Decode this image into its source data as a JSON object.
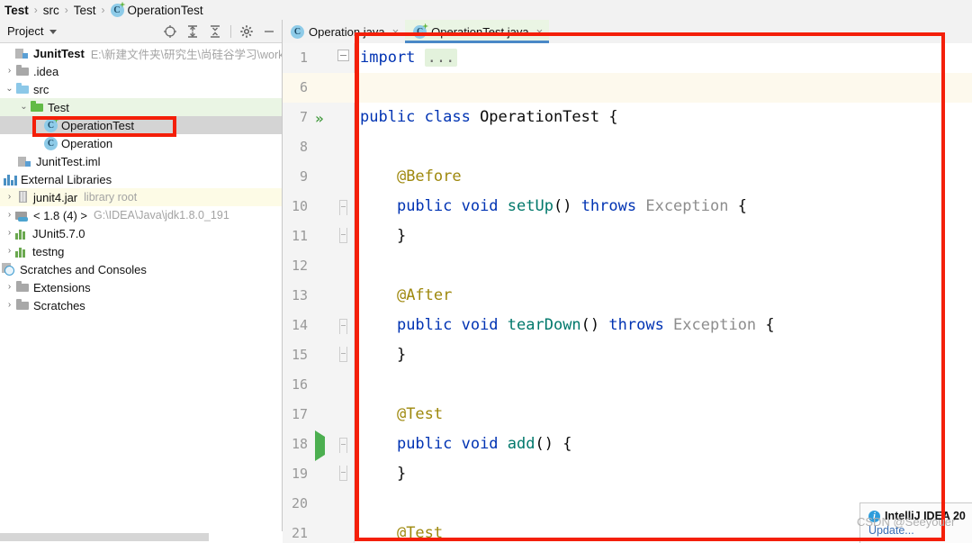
{
  "breadcrumb": {
    "items": [
      {
        "label": "Test",
        "icon": "none",
        "bold": true
      },
      {
        "label": "src",
        "icon": "none",
        "bold": false
      },
      {
        "label": "Test",
        "icon": "none",
        "bold": false
      },
      {
        "label": "OperationTest",
        "icon": "test-class-icon",
        "bold": false
      }
    ],
    "separator": "›"
  },
  "project_panel": {
    "title": "Project",
    "tools": [
      {
        "name": "locate-icon"
      },
      {
        "name": "expand-all-icon"
      },
      {
        "name": "collapse-all-icon"
      },
      {
        "name": "settings-gear-icon"
      },
      {
        "name": "hide-panel-icon"
      }
    ],
    "tree": [
      {
        "twist": "",
        "icon": "module-icon",
        "label": "JunitTest",
        "bold": true,
        "sub": "E:\\新建文件夹\\研究生\\尚硅谷学习\\workspa",
        "indent": 0,
        "state": "normal"
      },
      {
        "twist": "›",
        "icon": "folder-icon",
        "label": ".idea",
        "indent": 1,
        "state": "normal"
      },
      {
        "twist": "⌄",
        "icon": "folder-blue-icon",
        "label": "src",
        "indent": 1,
        "state": "normal"
      },
      {
        "twist": "⌄",
        "icon": "folder-green-icon",
        "label": "Test",
        "indent": 2,
        "state": "green"
      },
      {
        "twist": "",
        "icon": "test-class-icon",
        "label": "OperationTest",
        "indent": 3,
        "state": "selected"
      },
      {
        "twist": "",
        "icon": "class-icon",
        "label": "Operation",
        "indent": 2,
        "state": "normal"
      },
      {
        "twist": "",
        "icon": "iml-module-icon",
        "label": "JunitTest.iml",
        "indent": 1,
        "state": "normal"
      },
      {
        "twist": "",
        "icon": "libraries-icon",
        "label": "External Libraries",
        "indent": 0,
        "state": "normal"
      },
      {
        "twist": "›",
        "icon": "jar-icon",
        "label": "junit4.jar",
        "sub": "library root",
        "indent": 1,
        "state": "yellowish"
      },
      {
        "twist": "›",
        "icon": "sdk-icon",
        "label": "< 1.8 (4) >",
        "sub": "G:\\IDEA\\Java\\jdk1.8.0_191",
        "indent": 1,
        "state": "normal"
      },
      {
        "twist": "›",
        "icon": "library-icon",
        "label": "JUnit5.7.0",
        "indent": 1,
        "state": "normal"
      },
      {
        "twist": "›",
        "icon": "library-icon",
        "label": "testng",
        "indent": 1,
        "state": "normal"
      },
      {
        "twist": "",
        "icon": "scratches-icon",
        "label": "Scratches and Consoles",
        "indent": 0,
        "state": "normal"
      },
      {
        "twist": "›",
        "icon": "folder-icon",
        "label": "Extensions",
        "indent": 1,
        "state": "normal"
      },
      {
        "twist": "›",
        "icon": "folder-icon",
        "label": "Scratches",
        "indent": 1,
        "state": "normal"
      }
    ]
  },
  "editor": {
    "tabs": [
      {
        "label": "Operation.java",
        "icon": "class-icon",
        "active": false,
        "close": "×"
      },
      {
        "label": "OperationTest.java",
        "icon": "test-class-icon",
        "active": true,
        "close": "×"
      }
    ],
    "lines": [
      {
        "num": "1",
        "gutter": "fold-collapsed",
        "run": "",
        "caret": false,
        "tokens": [
          {
            "t": "import",
            "c": "k"
          },
          {
            "t": " ",
            "c": ""
          },
          {
            "t": "...",
            "c": "fold-ellipsis"
          }
        ]
      },
      {
        "num": "6",
        "gutter": "",
        "run": "",
        "caret": true,
        "tokens": []
      },
      {
        "num": "7",
        "gutter": "",
        "run": "run-all-icon",
        "caret": false,
        "tokens": [
          {
            "t": "public class ",
            "c": "k"
          },
          {
            "t": "OperationTest",
            "c": "cls"
          },
          {
            "t": " {",
            "c": "cls"
          }
        ]
      },
      {
        "num": "8",
        "gutter": "",
        "run": "",
        "caret": false,
        "tokens": []
      },
      {
        "num": "9",
        "gutter": "",
        "run": "",
        "caret": false,
        "tokens": [
          {
            "t": "    ",
            "c": ""
          },
          {
            "t": "@Before",
            "c": "ann"
          }
        ]
      },
      {
        "num": "10",
        "gutter": "brace-open",
        "run": "",
        "caret": false,
        "tokens": [
          {
            "t": "    ",
            "c": ""
          },
          {
            "t": "public void ",
            "c": "k"
          },
          {
            "t": "setUp",
            "c": "m"
          },
          {
            "t": "() ",
            "c": "cls"
          },
          {
            "t": "throws ",
            "c": "k"
          },
          {
            "t": "Exception",
            "c": "gray"
          },
          {
            "t": " {",
            "c": "cls"
          }
        ]
      },
      {
        "num": "11",
        "gutter": "brace-close",
        "run": "",
        "caret": false,
        "tokens": [
          {
            "t": "    }",
            "c": "cls"
          }
        ]
      },
      {
        "num": "12",
        "gutter": "",
        "run": "",
        "caret": false,
        "tokens": []
      },
      {
        "num": "13",
        "gutter": "",
        "run": "",
        "caret": false,
        "tokens": [
          {
            "t": "    ",
            "c": ""
          },
          {
            "t": "@After",
            "c": "ann"
          }
        ]
      },
      {
        "num": "14",
        "gutter": "brace-open",
        "run": "",
        "caret": false,
        "tokens": [
          {
            "t": "    ",
            "c": ""
          },
          {
            "t": "public void ",
            "c": "k"
          },
          {
            "t": "tearDown",
            "c": "m"
          },
          {
            "t": "() ",
            "c": "cls"
          },
          {
            "t": "throws ",
            "c": "k"
          },
          {
            "t": "Exception",
            "c": "gray"
          },
          {
            "t": " {",
            "c": "cls"
          }
        ]
      },
      {
        "num": "15",
        "gutter": "brace-close",
        "run": "",
        "caret": false,
        "tokens": [
          {
            "t": "    }",
            "c": "cls"
          }
        ]
      },
      {
        "num": "16",
        "gutter": "",
        "run": "",
        "caret": false,
        "tokens": []
      },
      {
        "num": "17",
        "gutter": "",
        "run": "",
        "caret": false,
        "tokens": [
          {
            "t": "    ",
            "c": ""
          },
          {
            "t": "@Test",
            "c": "ann"
          }
        ]
      },
      {
        "num": "18",
        "gutter": "brace-open",
        "run": "run-test-icon",
        "caret": false,
        "tokens": [
          {
            "t": "    ",
            "c": ""
          },
          {
            "t": "public void ",
            "c": "k"
          },
          {
            "t": "add",
            "c": "m"
          },
          {
            "t": "() {",
            "c": "cls"
          }
        ]
      },
      {
        "num": "19",
        "gutter": "brace-close",
        "run": "",
        "caret": false,
        "tokens": [
          {
            "t": "    }",
            "c": "cls"
          }
        ]
      },
      {
        "num": "20",
        "gutter": "",
        "run": "",
        "caret": false,
        "tokens": []
      },
      {
        "num": "21",
        "gutter": "",
        "run": "",
        "caret": false,
        "tokens": [
          {
            "t": "    ",
            "c": ""
          },
          {
            "t": "@Test",
            "c": "ann"
          }
        ]
      }
    ]
  },
  "notification": {
    "icon": "info-icon",
    "badge": "i",
    "title": "IntelliJ IDEA 20",
    "link": "Update..."
  },
  "watermark": {
    "text": "CSDN @Seeyouer"
  },
  "annotations": {
    "color": "#f41f09",
    "tree_highlight_label": "OperationTest",
    "editor_highlight_label": "code-region"
  }
}
